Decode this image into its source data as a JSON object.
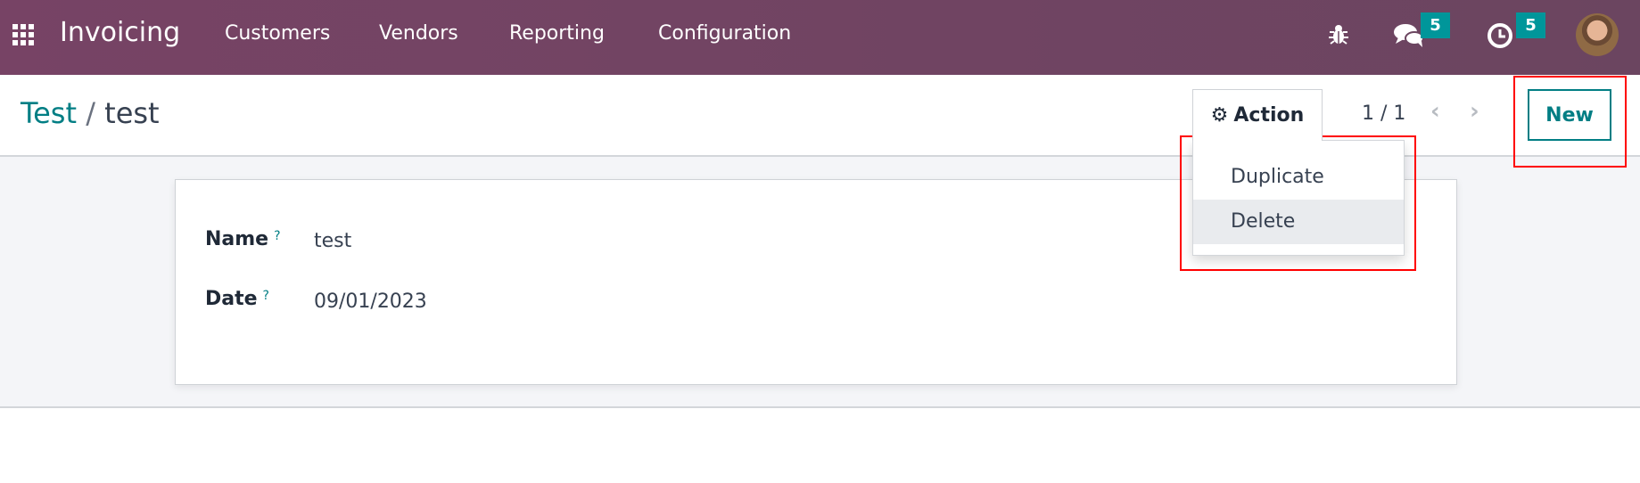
{
  "navbar": {
    "app_name": "Invoicing",
    "menu": [
      "Customers",
      "Vendors",
      "Reporting",
      "Configuration"
    ],
    "messages_badge": "5",
    "activities_badge": "5",
    "brand_color": "#714B67"
  },
  "breadcrumb": {
    "parent": "Test",
    "separator": "/",
    "current": "test"
  },
  "control": {
    "action_label": "Action",
    "pager": "1 / 1",
    "new_label": "New"
  },
  "action_menu": {
    "items": [
      "Duplicate",
      "Delete"
    ],
    "highlighted": "Delete"
  },
  "form": {
    "fields": [
      {
        "label": "Name",
        "help": "?",
        "value": "test"
      },
      {
        "label": "Date",
        "help": "?",
        "value": "09/01/2023"
      }
    ]
  },
  "colors": {
    "accent": "#017e84",
    "highlight": "#ff0000"
  }
}
